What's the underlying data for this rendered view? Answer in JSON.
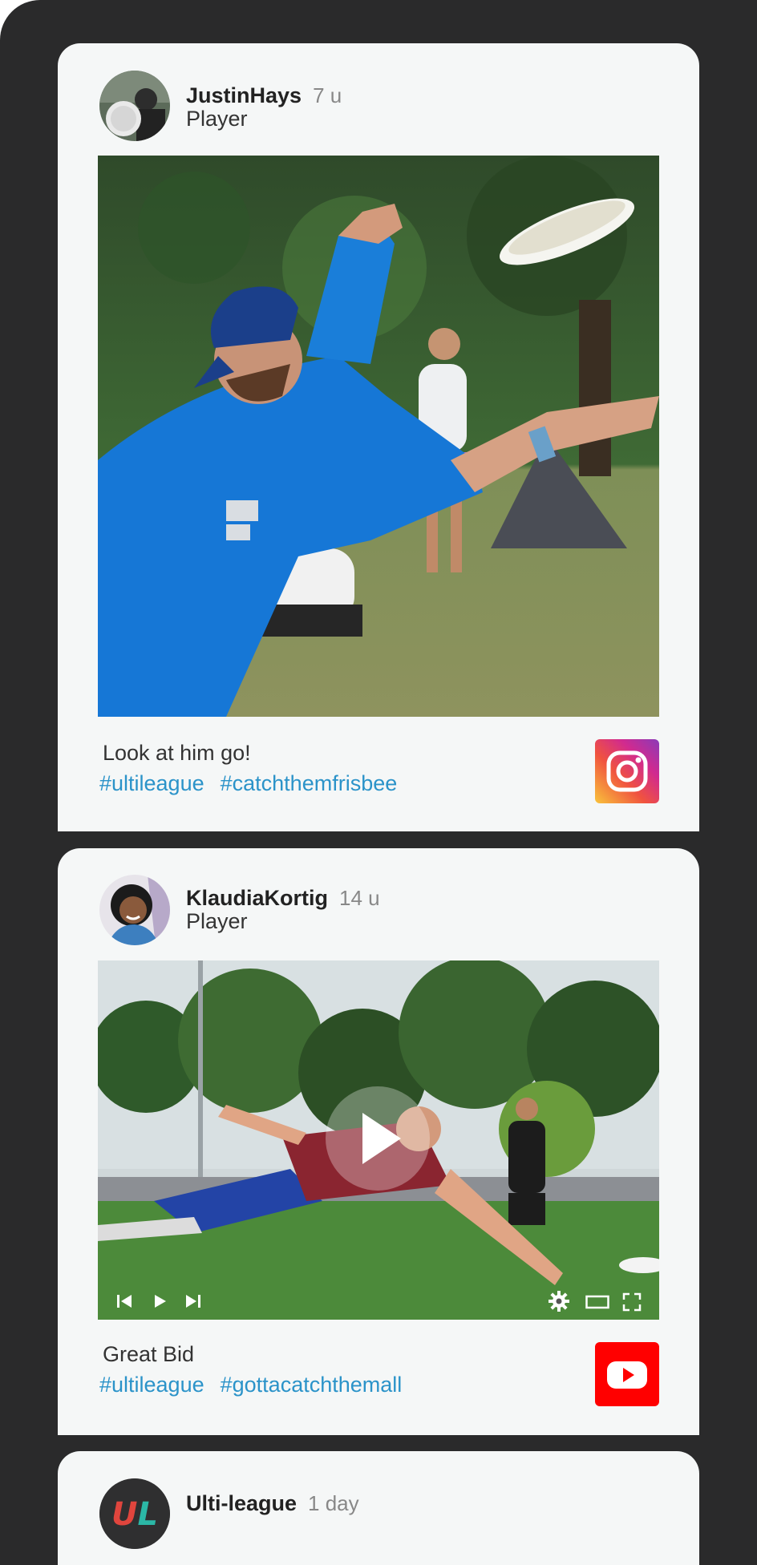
{
  "posts": [
    {
      "username": "JustinHays",
      "time": "7 u",
      "role": "Player",
      "caption": "Look at him go!",
      "tags": [
        "#ultileague",
        "#catchthemfrisbee"
      ],
      "source_icon": "instagram-icon",
      "media_type": "photo"
    },
    {
      "username": "KlaudiaKortig",
      "time": "14 u",
      "role": "Player",
      "caption": "Great Bid",
      "tags": [
        "#ultileague",
        "#gottacatchthemall"
      ],
      "source_icon": "youtube-icon",
      "media_type": "video"
    },
    {
      "username": "Ulti-league",
      "time": "1 day",
      "avatar_logo_text": "UL"
    }
  ],
  "colors": {
    "background": "#2a2a2b",
    "card": "#f5f7f7",
    "hashtag": "#2b93c9",
    "youtube": "#ff0000"
  }
}
